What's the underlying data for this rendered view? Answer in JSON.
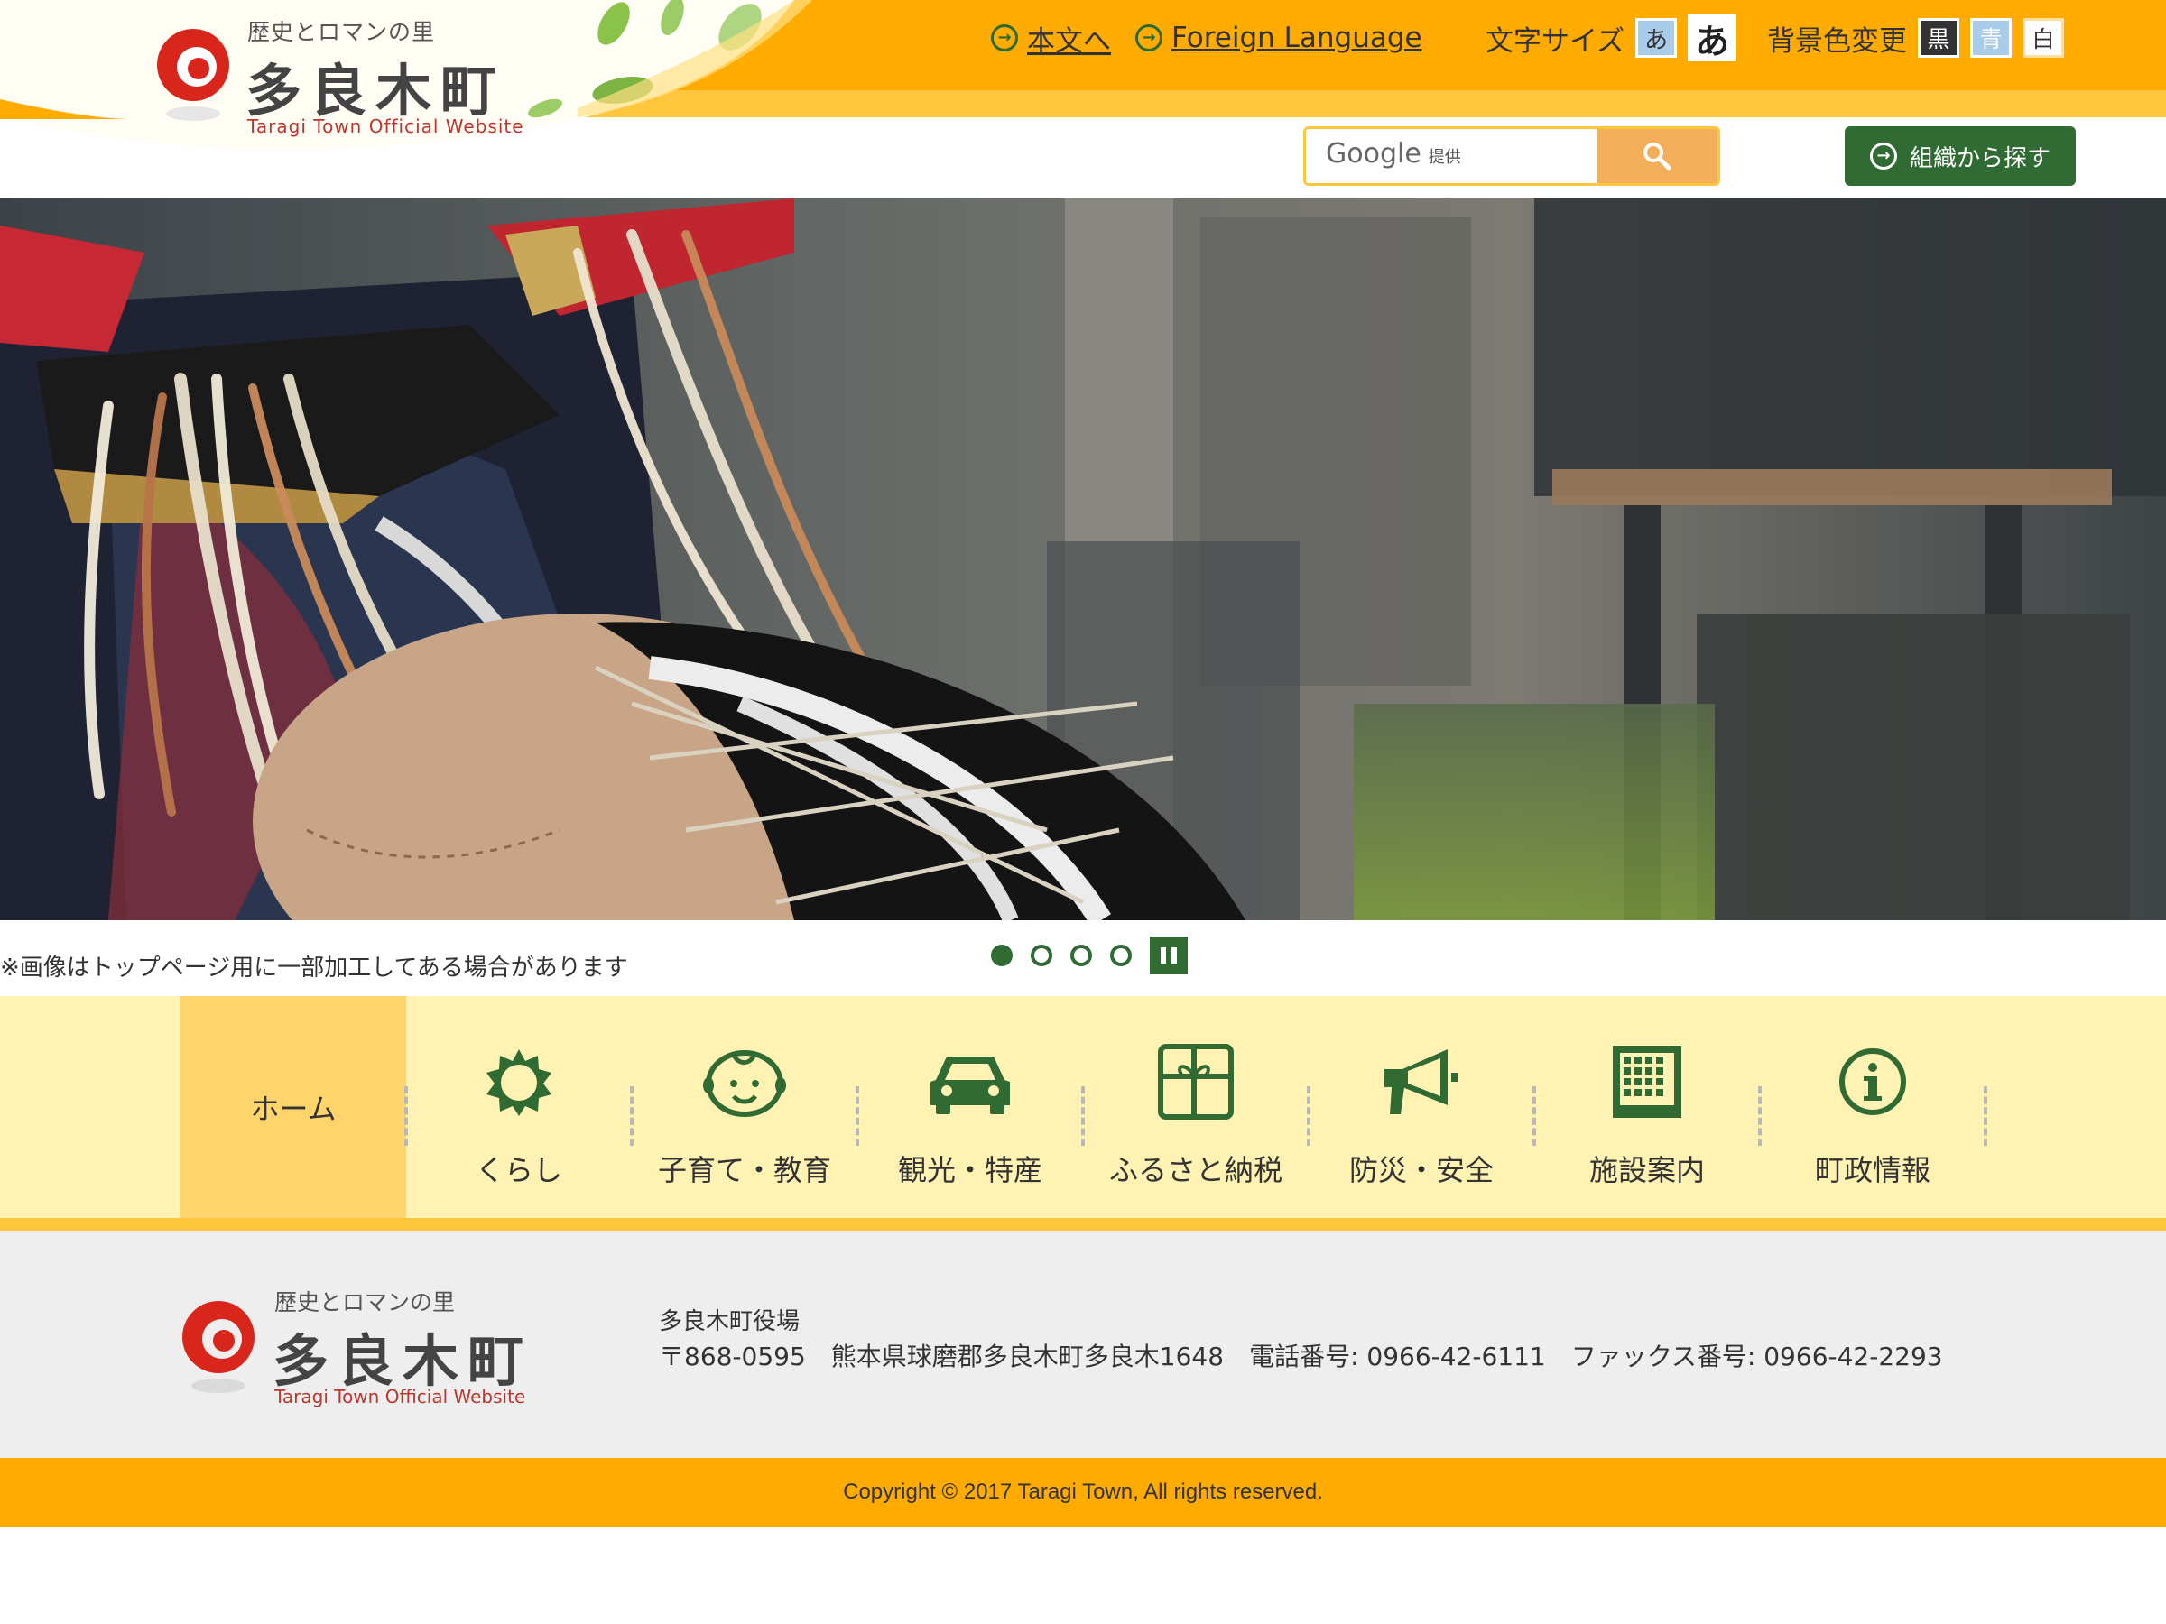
{
  "header": {
    "logo": {
      "catchphrase": "歴史とロマンの里",
      "name": "多良木町",
      "english": "Taragi Town Official Website"
    },
    "util": {
      "honbun_label": "本文へ",
      "foreign_label": "Foreign Language",
      "fontsize_label": "文字サイズ",
      "font_small": "あ",
      "font_large": "あ",
      "bgcolor_label": "背景色変更",
      "bg_black": "黒",
      "bg_blue": "青",
      "bg_white": "白"
    },
    "search": {
      "brand": "Google",
      "brand_sub": "提供"
    },
    "org_button": "組織から探す"
  },
  "slider": {
    "note": "※画像はトップページ用に一部加工してある場合があります",
    "dot_count": 4,
    "active_index": 0
  },
  "nav": {
    "items": [
      {
        "label": "ホーム",
        "icon": "home"
      },
      {
        "label": "くらし",
        "icon": "sun-icon"
      },
      {
        "label": "子育て・教育",
        "icon": "baby-face-icon"
      },
      {
        "label": "観光・特産",
        "icon": "car-icon"
      },
      {
        "label": "ふるさと納税",
        "icon": "gift-icon"
      },
      {
        "label": "防災・安全",
        "icon": "megaphone-icon"
      },
      {
        "label": "施設案内",
        "icon": "building-icon"
      },
      {
        "label": "町政情報",
        "icon": "info-icon"
      }
    ]
  },
  "footer": {
    "logo": {
      "catchphrase": "歴史とロマンの里",
      "name": "多良木町",
      "english": "Taragi Town Official Website"
    },
    "office_name": "多良木町役場",
    "office_address": "〒868-0595　熊本県球磨郡多良木町多良木1648　電話番号: 0966-42-6111　ファックス番号: 0966-42-2293",
    "copyright": "Copyright © 2017 Taragi Town, All rights reserved."
  },
  "colors": {
    "orange": "#ffab00",
    "light_orange": "#ffc53d",
    "green": "#2f6b33",
    "nav_bg": "#fff2b3",
    "nav_home_bg": "#ffd46b",
    "footer_bg": "#eeeeee"
  }
}
